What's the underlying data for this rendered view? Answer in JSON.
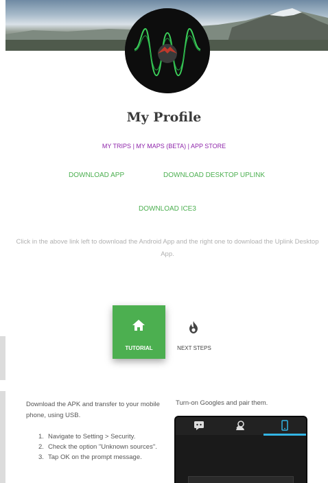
{
  "profile": {
    "title": "My Profile"
  },
  "nav_links": {
    "trips": "MY TRIPS",
    "sep1": " | ",
    "maps": "MY MAPS (BETA)",
    "sep2": " | ",
    "store": "APP STORE"
  },
  "downloads": {
    "app": "DOWNLOAD APP",
    "desktop": "DOWNLOAD DESKTOP UPLINK",
    "ice3": "DOWNLOAD ICE3"
  },
  "description": "Click in the above link left to download the Android App and the right one to download the Uplink Desktop App.",
  "tabs": [
    {
      "label": "TUTORIAL",
      "icon": "home-icon",
      "active": true
    },
    {
      "label": "NEXT STEPS",
      "icon": "flame-icon",
      "active": false
    }
  ],
  "tutorial": {
    "intro": "Download the APK and transfer to your mobile phone, using USB.",
    "steps": [
      {
        "num": "1.",
        "text": "Navigate to Setting > Security."
      },
      {
        "num": "2.",
        "text": "Check the option \"Unknown sources\"."
      },
      {
        "num": "3.",
        "text": "Tap OK on the prompt message."
      }
    ],
    "pair_text": "Turn-on Googles and pair them."
  },
  "colors": {
    "accent_green": "#4caf50",
    "link_purple": "#8e24aa",
    "phone_tab_blue": "#33b5e5"
  }
}
